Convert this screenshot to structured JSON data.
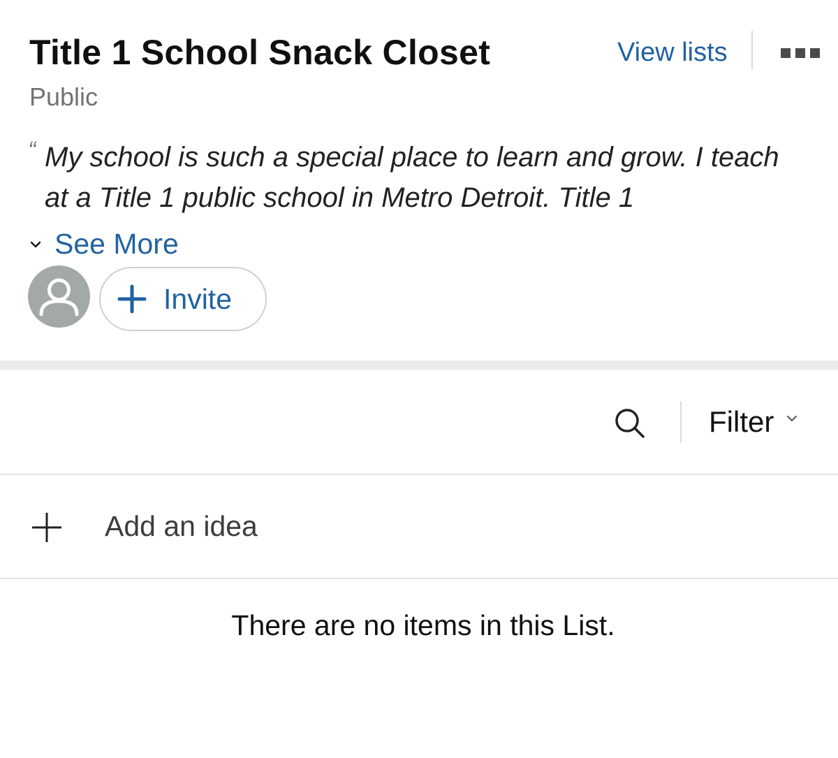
{
  "list": {
    "title": "Title 1 School Snack Closet",
    "privacy": "Public",
    "open_quote": "“",
    "description": "My school is such a special place to learn and grow. I teach at a Title 1 public school in Metro Detroit. Title 1",
    "see_more_label": "See More"
  },
  "header": {
    "view_lists_label": "View lists",
    "more_icon": "more-horizontal-icon"
  },
  "collaborators": {
    "avatar_icon": "user-silhouette-icon",
    "invite_label": "Invite"
  },
  "toolbar": {
    "search_icon": "search-icon",
    "filter_label": "Filter"
  },
  "items": {
    "add_idea_label": "Add an idea",
    "empty_message": "There are no items in this List."
  },
  "colors": {
    "link_blue": "#2162a1",
    "muted_text": "#6f7373",
    "avatar_gray": "#a3a8a8",
    "divider": "#e3e3e3",
    "section_band": "#ececec"
  }
}
